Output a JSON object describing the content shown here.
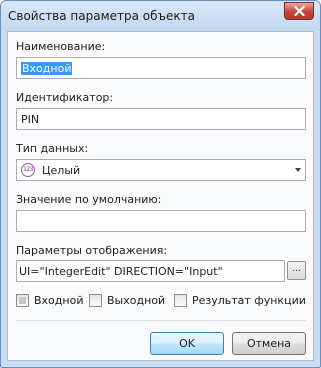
{
  "dialog": {
    "title": "Свойства параметра объекта"
  },
  "form": {
    "name_label": "Наименование:",
    "name_value": "Входной",
    "id_label": "Идентификатор:",
    "id_value": "PIN",
    "type_label": "Тип данных:",
    "type_badge": "123",
    "type_value": "Целый",
    "default_label": "Значение по умолчанию:",
    "default_value": "",
    "display_label": "Параметры отображения:",
    "display_value": "UI=\"IntegerEdit\" DIRECTION=\"Input\"",
    "browse_label": "..."
  },
  "checkboxes": [
    {
      "label": "Входной",
      "checked": true
    },
    {
      "label": "Выходной",
      "checked": false
    },
    {
      "label": "Результат функции",
      "checked": false
    }
  ],
  "buttons": {
    "ok": "OK",
    "cancel": "Отмена"
  }
}
